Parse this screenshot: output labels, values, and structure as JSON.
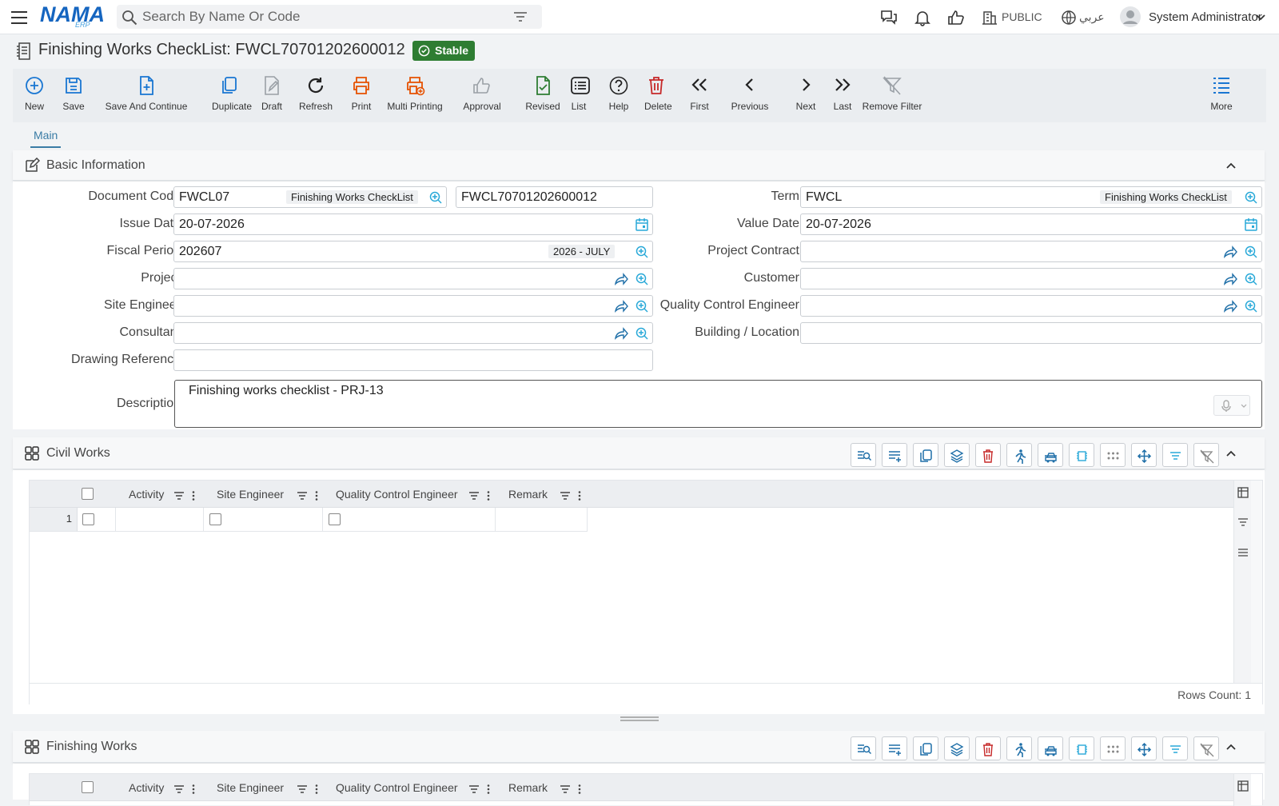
{
  "header": {
    "search_placeholder": "Search By Name Or Code",
    "logo_main": "NAMA",
    "logo_sub": "ERP",
    "public_label": "PUBLIC",
    "language_label": "عربي",
    "user_name": "System Administrator"
  },
  "title": {
    "text": "Finishing Works CheckList: FWCL70701202600012",
    "status": "Stable"
  },
  "toolbar": [
    {
      "label": "New",
      "icon": "plus-circle-icon",
      "color": "#1976d2"
    },
    {
      "label": "Save",
      "icon": "save-icon",
      "color": "#1976d2"
    },
    {
      "label": "Save And Continue",
      "icon": "file-plus-icon",
      "color": "#1976d2"
    },
    {
      "label": "Duplicate",
      "icon": "copy-icon",
      "color": "#1976d2"
    },
    {
      "label": "Draft",
      "icon": "draft-icon",
      "color": "#9aa0a6"
    },
    {
      "label": "Refresh",
      "icon": "refresh-icon",
      "color": "#222"
    },
    {
      "label": "Print",
      "icon": "print-icon",
      "color": "#e65100"
    },
    {
      "label": "Multi Printing",
      "icon": "multi-print-icon",
      "color": "#e65100"
    },
    {
      "label": "Approval",
      "icon": "thumbs-up-icon",
      "color": "#9aa0a6"
    },
    {
      "label": "Revised",
      "icon": "file-check-icon",
      "color": "#2e7d32"
    },
    {
      "label": "List",
      "icon": "list-icon",
      "color": "#222"
    },
    {
      "label": "Help",
      "icon": "help-icon",
      "color": "#222"
    },
    {
      "label": "Delete",
      "icon": "trash-icon",
      "color": "#c62828"
    },
    {
      "label": "First",
      "icon": "double-chevron-left-icon",
      "color": "#222"
    },
    {
      "label": "Previous",
      "icon": "chevron-left-icon",
      "color": "#222"
    },
    {
      "label": "Next",
      "icon": "chevron-right-icon",
      "color": "#222"
    },
    {
      "label": "Last",
      "icon": "double-chevron-right-icon",
      "color": "#222"
    },
    {
      "label": "Remove Filter",
      "icon": "filter-off-icon",
      "color": "#9aa0a6"
    },
    {
      "label": "More",
      "icon": "more-list-icon",
      "color": "#1976d2"
    }
  ],
  "tabs": {
    "main": "Main"
  },
  "basic": {
    "title": "Basic Information",
    "document_code_label": "Document Code",
    "document_code": "FWCL07",
    "document_code_tag": "Finishing Works CheckList",
    "document_number": "FWCL70701202600012",
    "term_label": "Term",
    "term": "FWCL",
    "term_tag": "Finishing Works CheckList",
    "issue_date_label": "Issue Date",
    "issue_date": "20-07-2026",
    "value_date_label": "Value Date",
    "value_date": "20-07-2026",
    "fiscal_period_label": "Fiscal Period",
    "fiscal_period": "202607",
    "fiscal_period_tag": "2026 - JULY",
    "project_contract_label": "Project Contract",
    "project_label": "Project",
    "customer_label": "Customer",
    "site_engineer_label": "Site Engineer",
    "qc_engineer_label": "Quality Control Engineer",
    "consultant_label": "Consultant",
    "building_label": "Building / Location",
    "drawing_label": "Drawing Reference",
    "description_label": "Description",
    "description": "Finishing works checklist - PRJ-13"
  },
  "civil": {
    "title": "Civil Works",
    "columns": [
      "Activity",
      "Site Engineer",
      "Quality Control Engineer",
      "Remark"
    ],
    "rows": [
      {
        "num": "1"
      }
    ],
    "rows_count": "Rows Count: 1"
  },
  "finishing": {
    "title": "Finishing Works",
    "columns": [
      "Activity",
      "Site Engineer",
      "Quality Control Engineer",
      "Remark"
    ]
  }
}
